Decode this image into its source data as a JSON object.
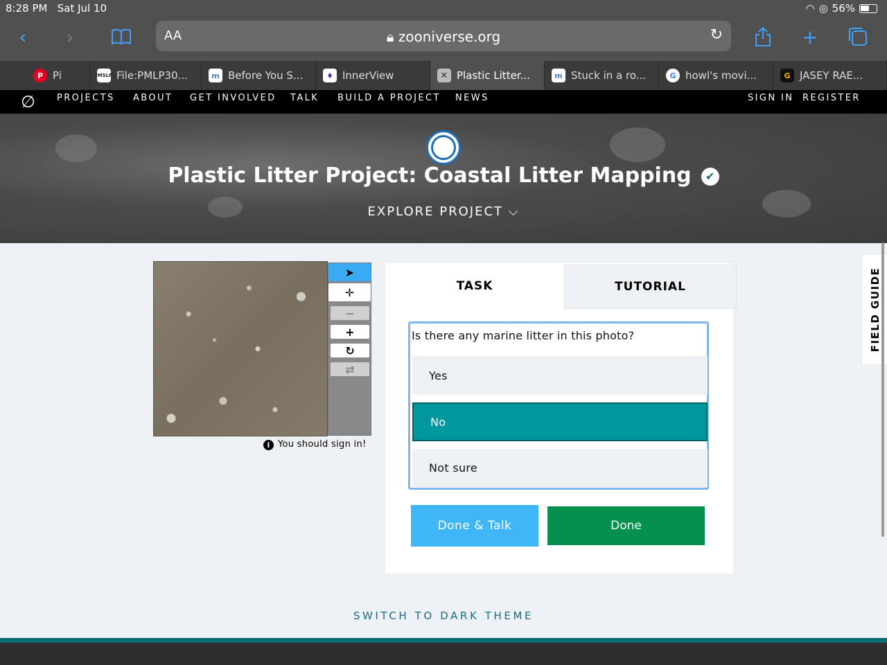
{
  "status": {
    "time": "8:28 PM",
    "date": "Sat Jul 10",
    "battery": "56%"
  },
  "browser": {
    "aa_label": "AA",
    "url": "zooniverse.org",
    "tabs": [
      {
        "label": "Pi",
        "favicon_color": "#e60023"
      },
      {
        "label": "File:PMLP30...",
        "favicon_color": "#2a2a2a"
      },
      {
        "label": "Before You S...",
        "favicon_color": "#4a86c8"
      },
      {
        "label": "InnerView",
        "favicon_color": "#6b2fa1"
      },
      {
        "label": "Plastic Litter...",
        "favicon_color": "#888888"
      },
      {
        "label": "Stuck in a ro...",
        "favicon_color": "#4a86c8"
      },
      {
        "label": "howl's movi...",
        "favicon_color": "#4285f4"
      },
      {
        "label": "JASEY RAE...",
        "favicon_color": "#f5b400"
      }
    ]
  },
  "nav": {
    "items": [
      "PROJECTS",
      "ABOUT",
      "GET INVOLVED",
      "TALK",
      "BUILD A PROJECT",
      "NEWS"
    ],
    "sign_in": "SIGN IN",
    "register": "REGISTER"
  },
  "hero": {
    "title": "Plastic Litter Project: Coastal Litter Mapping",
    "explore": "EXPLORE PROJECT"
  },
  "viewer": {
    "sign_in_note": "You should sign in!"
  },
  "task_panel": {
    "tab_task": "TASK",
    "tab_tutorial": "TUTORIAL",
    "question": "Is there any marine litter in this photo?",
    "answers": [
      "Yes",
      "No",
      "Not sure"
    ],
    "selected_answer": "No",
    "done_talk": "Done & Talk",
    "done": "Done"
  },
  "field_guide": "FIELD GUIDE",
  "dark_theme": "SWITCH TO DARK THEME",
  "colors": {
    "accent_teal": "#00979d",
    "done_green": "#06904e",
    "talk_blue": "#3fb6f6"
  }
}
